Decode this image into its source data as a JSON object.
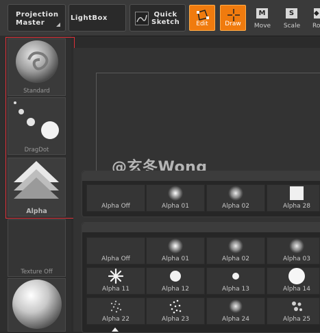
{
  "toolbar": {
    "projection_master": "Projection Master",
    "lightbox": "LightBox",
    "quick_sketch": "Quick Sketch",
    "edit": "Edit",
    "draw": "Draw",
    "move": "Move",
    "scale": "Scale",
    "rotate_partial": "Ro",
    "accent_color": "#f07b0e"
  },
  "brushes": {
    "standard": "Standard",
    "dragdot": "DragDot",
    "alpha": "Alpha",
    "texture": "Texture Off"
  },
  "watermark": "@玄冬Wong",
  "recent_alphas": [
    "Alpha Off",
    "Alpha 01",
    "Alpha 02",
    "Alpha 28"
  ],
  "alpha_grid": [
    "Alpha Off",
    "Alpha 01",
    "Alpha 02",
    "Alpha 03",
    "Alpha 11",
    "Alpha 12",
    "Alpha 13",
    "Alpha 14",
    "Alpha 22",
    "Alpha 23",
    "Alpha 24",
    "Alpha 25"
  ]
}
